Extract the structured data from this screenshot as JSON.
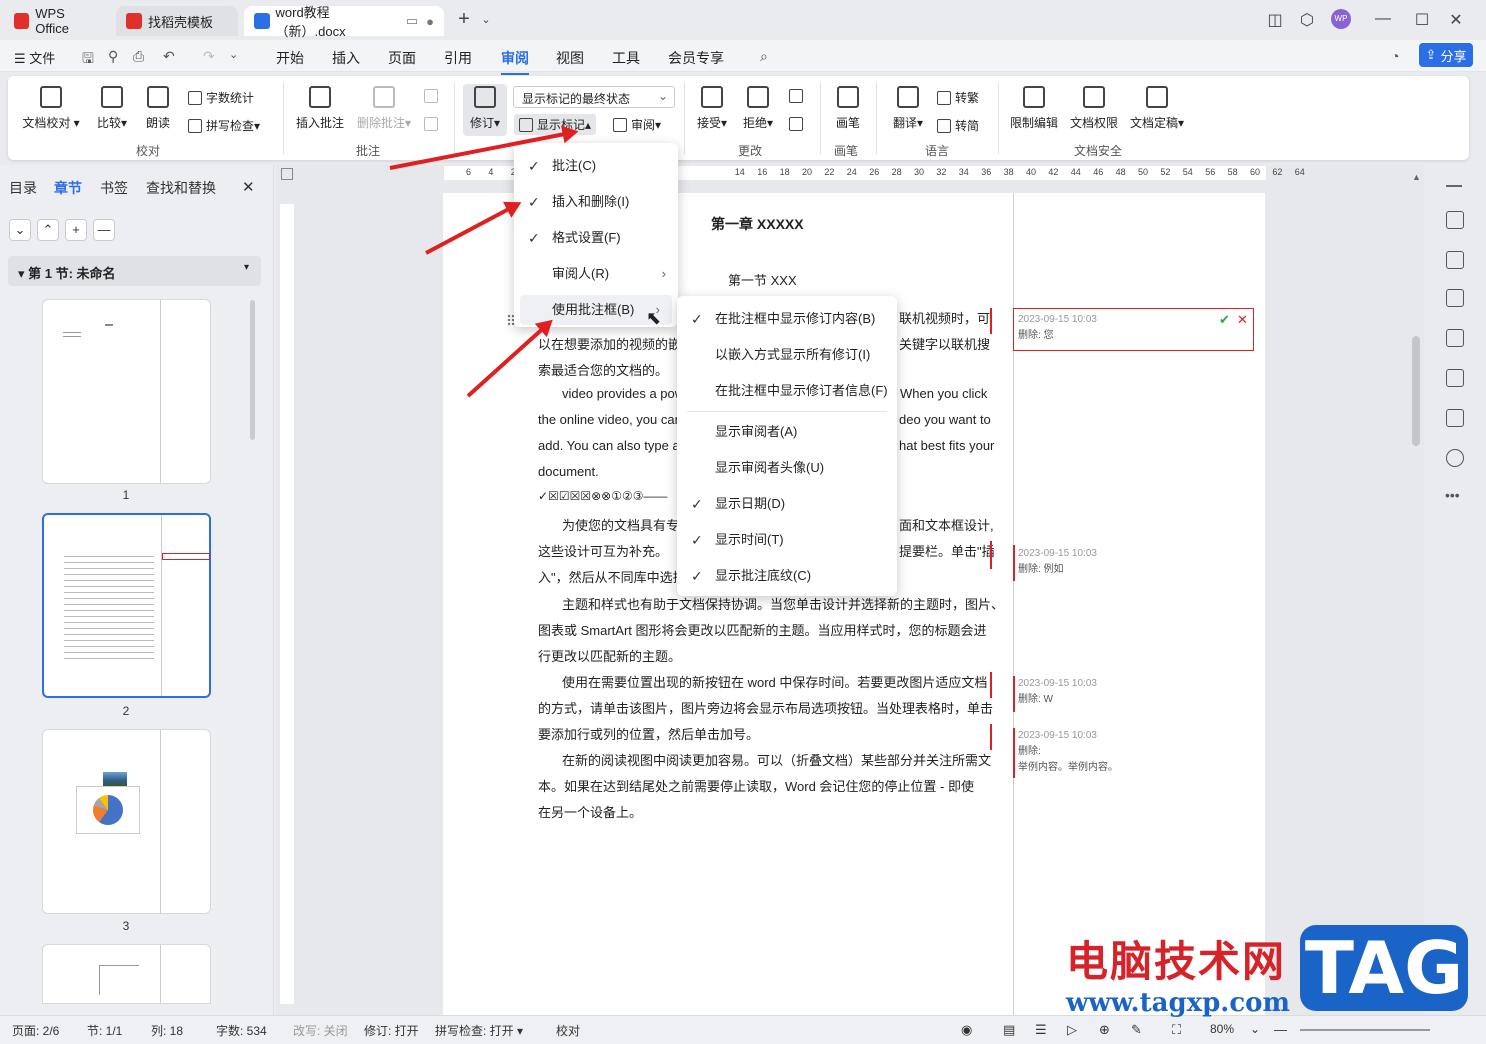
{
  "titlebar": {
    "tabs": [
      "WPS Office",
      "找稻壳模板",
      "word教程（新）.docx"
    ],
    "new_tab": "+",
    "avatar": "WP"
  },
  "menubar": {
    "file": "文件",
    "items": [
      "开始",
      "插入",
      "页面",
      "引用",
      "审阅",
      "视图",
      "工具",
      "会员专享"
    ],
    "active": "审阅",
    "share": "分享"
  },
  "ribbon": {
    "doc_check": "文档校对",
    "compare": "比较",
    "read": "朗读",
    "word_count": "字数统计",
    "spell": "拼写检查",
    "group_check": "校对",
    "insert_comment": "插入批注",
    "delete_comment": "删除批注",
    "group_comment": "批注",
    "revise": "修订",
    "display_state": "显示标记的最终状态",
    "show_markup": "显示标记",
    "review": "审阅",
    "accept": "接受",
    "reject": "拒绝",
    "group_change": "更改",
    "pen": "画笔",
    "group_pen": "画笔",
    "translate": "翻译",
    "trad": "转繁",
    "simp": "转简",
    "group_lang": "语言",
    "restrict": "限制编辑",
    "perm": "文档权限",
    "final": "文档定稿",
    "group_security": "文档安全"
  },
  "leftpanel": {
    "tabs": [
      "目录",
      "章节",
      "书签",
      "查找和替换"
    ],
    "active": "章节",
    "section": "第 1 节: 未命名",
    "pages": [
      "1",
      "2",
      "3"
    ]
  },
  "ruler": {
    "ticks": [
      "6",
      "4",
      "2",
      "",
      "",
      "",
      "",
      "",
      "",
      "",
      "",
      "",
      "14",
      "16",
      "18",
      "20",
      "22",
      "24",
      "26",
      "28",
      "30",
      "32",
      "34",
      "36",
      "38",
      "40",
      "42",
      "44",
      "46",
      "48",
      "50",
      "52",
      "54",
      "56",
      "58",
      "60",
      "62",
      "64"
    ]
  },
  "document": {
    "chapter": "第一章  XXXXX",
    "section": "第一节  XXX",
    "lines": [
      "联机视频时，可",
      "以在想要添加的视频的嵌",
      "关键字以联机搜",
      "索最适合您的文档的。",
      "video provides a pow",
      "When you click",
      "the online video, you can",
      "deo you want to",
      "add. You can also type a",
      "hat best fits your",
      "document.",
      "✓☒☑☒☒⊗⊗①②③——",
      "为使您的文档具有专",
      "面和文本框设计,",
      "这些设计可互为补充。",
      "提要栏。单击\"插",
      "入\"，然后从不同库中选择",
      "主题和样式也有助于文档保持协调。当您单击设计并选择新的主题时，图片、",
      "图表或 SmartArt 图形将会更改以匹配新的主题。当应用样式时，您的标题会进",
      "行更改以匹配新的主题。",
      "使用在需要位置出现的新按钮在 word 中保存时间。若要更改图片适应文档",
      "的方式，请单击该图片，图片旁边将会显示布局选项按钮。当处理表格时，单击",
      "要添加行或列的位置，然后单击加号。",
      "在新的阅读视图中阅读更加容易。可以（折叠文档）某些部分并关注所需文",
      "本。如果在达到结尾处之前需要停止读取，Word 会记住您的停止位置 - 即使",
      "在另一个设备上。"
    ],
    "comments": [
      {
        "date": "2023-09-15 10:03",
        "text": "删除: 您"
      },
      {
        "date": "2023-09-15 10:03",
        "text": "删除: 例如"
      },
      {
        "date": "2023-09-15 10:03",
        "text": "删除: W"
      },
      {
        "date": "2023-09-15 10:03",
        "text": "删除:",
        "extra": "举例内容。举例内容。"
      }
    ]
  },
  "menu1": {
    "items": [
      "批注(C)",
      "插入和删除(I)",
      "格式设置(F)",
      "审阅人(R)",
      "使用批注框(B)"
    ]
  },
  "menu2": {
    "items": [
      "在批注框中显示修订内容(B)",
      "以嵌入方式显示所有修订(I)",
      "在批注框中显示修订者信息(F)",
      "显示审阅者(A)",
      "显示审阅者头像(U)",
      "显示日期(D)",
      "显示时间(T)",
      "显示批注底纹(C)"
    ]
  },
  "statusbar": {
    "page": "页面: 2/6",
    "section": "节: 1/1",
    "col": "列: 18",
    "words": "字数: 534",
    "mark": "改写: 关闭",
    "revise": "修订: 打开",
    "spell": "拼写检查: 打开",
    "check": "校对",
    "zoom": "80%"
  },
  "watermark": {
    "cn": "电脑技术网",
    "url": "www.tagxp.com",
    "tag": "TAG"
  },
  "colors": {
    "accent": "#2b6ee6",
    "revision": "#d6232a",
    "arrow": "#e02020"
  }
}
